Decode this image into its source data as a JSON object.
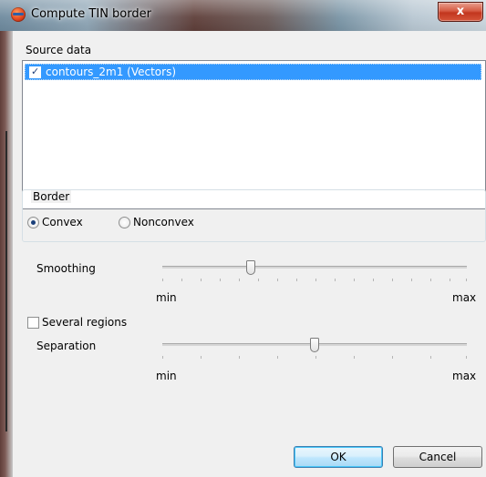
{
  "window": {
    "title": "Compute TIN border",
    "close_glyph": "x"
  },
  "source": {
    "label": "Source data",
    "items": [
      {
        "label": "contours_2m1 (Vectors)",
        "checked": true,
        "selected": true
      }
    ]
  },
  "border": {
    "label": "Border",
    "options": [
      {
        "label": "Convex",
        "selected": true
      },
      {
        "label": "Nonconvex",
        "selected": false
      }
    ]
  },
  "smoothing": {
    "label": "Smoothing",
    "min_label": "min",
    "max_label": "max",
    "value": 0.29
  },
  "several_regions": {
    "label": "Several regions",
    "checked": false
  },
  "separation": {
    "label": "Separation",
    "min_label": "min",
    "max_label": "max",
    "value": 0.5
  },
  "buttons": {
    "ok": "OK",
    "cancel": "Cancel"
  }
}
